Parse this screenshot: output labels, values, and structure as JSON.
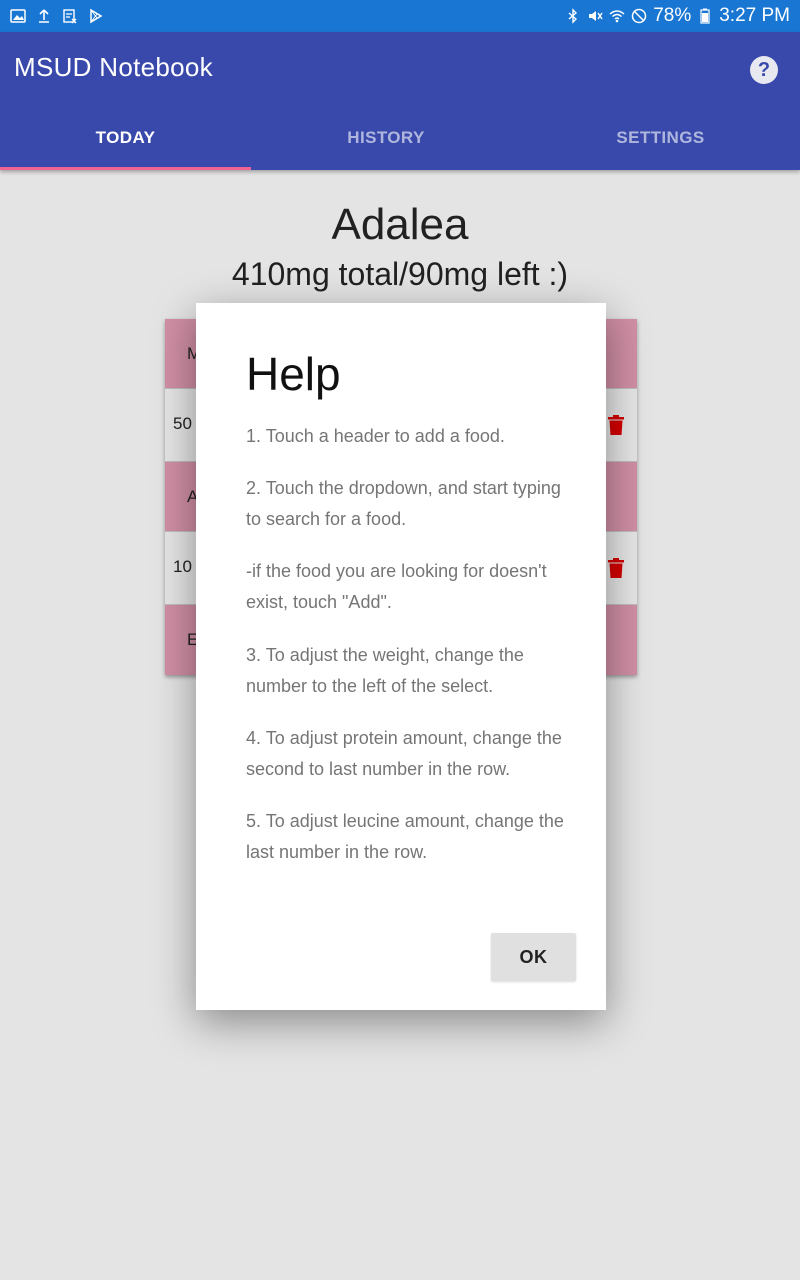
{
  "status_bar": {
    "battery": "78%",
    "time": "3:27 PM"
  },
  "app": {
    "title": "MSUD Notebook"
  },
  "tabs": [
    {
      "label": "TODAY"
    },
    {
      "label": "HISTORY"
    },
    {
      "label": "SETTINGS"
    }
  ],
  "main": {
    "name": "Adalea",
    "totals": "410mg total/90mg left :)"
  },
  "table": {
    "header_1": "M",
    "row_1_weight": "50",
    "header_2": "A",
    "row_2_weight": "10",
    "header_3": "E"
  },
  "dialog": {
    "title": "Help",
    "lines": [
      "1. Touch a header to add a food.",
      "2. Touch the dropdown, and start typing to search for a food.",
      "-if the food you are looking for doesn't exist, touch \"Add\".",
      "3. To adjust the weight, change the number to the left of the select.",
      "4. To adjust protein amount, change the second to last number in the row.",
      "5. To adjust leucine amount, change the last number in the row."
    ],
    "ok_label": "OK"
  },
  "colors": {
    "status_bar": "#1976d2",
    "app_bar": "#3949ab",
    "tab_indicator": "#f06292",
    "table_header": "#d18fa5",
    "trash": "#d50000"
  }
}
